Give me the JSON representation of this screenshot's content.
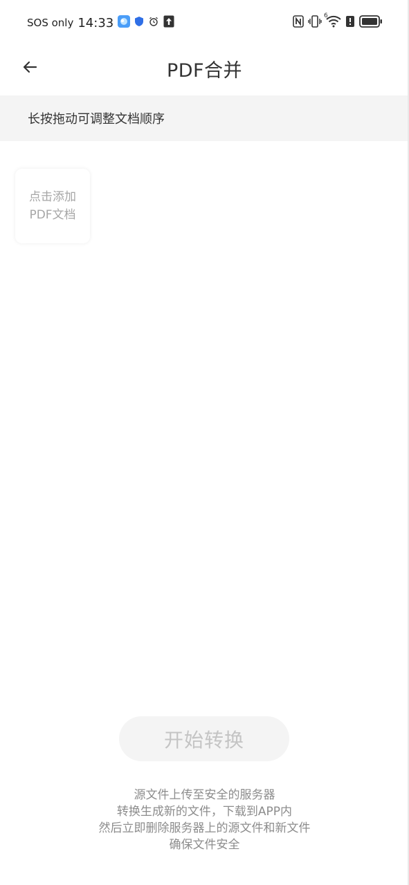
{
  "status_bar": {
    "carrier": "SOS only",
    "time": "14:33",
    "left_icons": [
      "weather-app-icon",
      "shield-icon",
      "alarm-icon",
      "upload-icon"
    ],
    "right_icons": [
      "nfc-icon",
      "vibrate-icon",
      "wifi-6-icon",
      "battery-alert-icon",
      "battery-icon"
    ],
    "wifi_label": "6"
  },
  "app_bar": {
    "back_icon": "arrow-left-icon",
    "title": "PDF合并"
  },
  "hint": "长按拖动可调整文档顺序",
  "add_tile": {
    "line1": "点击添加",
    "line2": "PDF文档"
  },
  "convert_button": {
    "label": "开始转换",
    "enabled": false
  },
  "footer": {
    "line1": "源文件上传至安全的服务器",
    "line2": "转换生成新的文件，下载到APP内",
    "line3": "然后立即删除服务器上的源文件和新文件",
    "line4": "确保文件安全"
  },
  "colors": {
    "banner_bg": "#f4f4f4",
    "button_bg": "#f4f4f4",
    "button_text_disabled": "#c4c4c4",
    "footer_text": "#8c8c8c",
    "tile_text": "#a6a6a6"
  }
}
